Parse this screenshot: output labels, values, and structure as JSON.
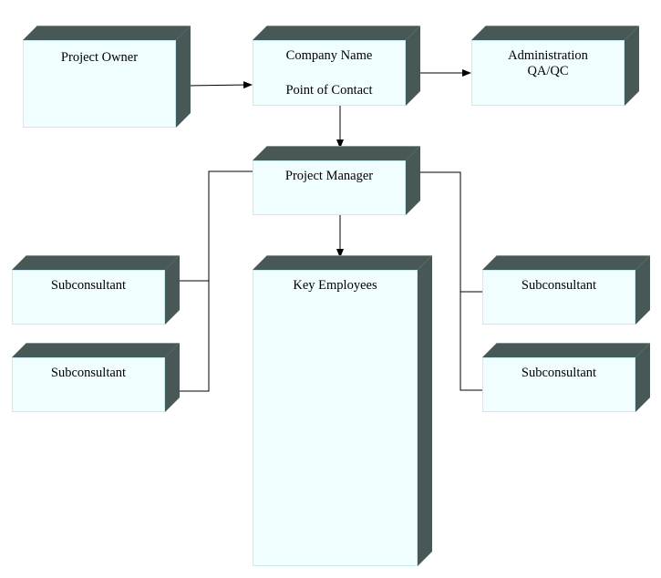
{
  "colors": {
    "face": "#f0feff",
    "face_border": "#c6ecef",
    "shade": "#475856",
    "line": "#000000"
  },
  "nodes": {
    "owner": {
      "lines": [
        "Project Owner"
      ]
    },
    "company": {
      "lines": [
        "Company Name",
        "",
        "Point of Contact"
      ]
    },
    "admin": {
      "lines": [
        "Administration",
        "QA/QC"
      ]
    },
    "pm": {
      "lines": [
        "Project Manager"
      ]
    },
    "key": {
      "lines": [
        "Key Employees"
      ]
    },
    "sub_l1": {
      "lines": [
        "Subconsultant"
      ]
    },
    "sub_l2": {
      "lines": [
        "Subconsultant"
      ]
    },
    "sub_r1": {
      "lines": [
        "Subconsultant"
      ]
    },
    "sub_r2": {
      "lines": [
        "Subconsultant"
      ]
    }
  },
  "edges": [
    {
      "from": "owner",
      "to": "company",
      "arrow": true
    },
    {
      "from": "company",
      "to": "admin",
      "arrow": true
    },
    {
      "from": "company",
      "to": "pm",
      "arrow": true
    },
    {
      "from": "pm",
      "to": "key",
      "arrow": true
    },
    {
      "from": "pm",
      "to": "sub_l1",
      "arrow": false
    },
    {
      "from": "pm",
      "to": "sub_l2",
      "arrow": false
    },
    {
      "from": "pm",
      "to": "sub_r1",
      "arrow": false
    },
    {
      "from": "pm",
      "to": "sub_r2",
      "arrow": false
    }
  ]
}
